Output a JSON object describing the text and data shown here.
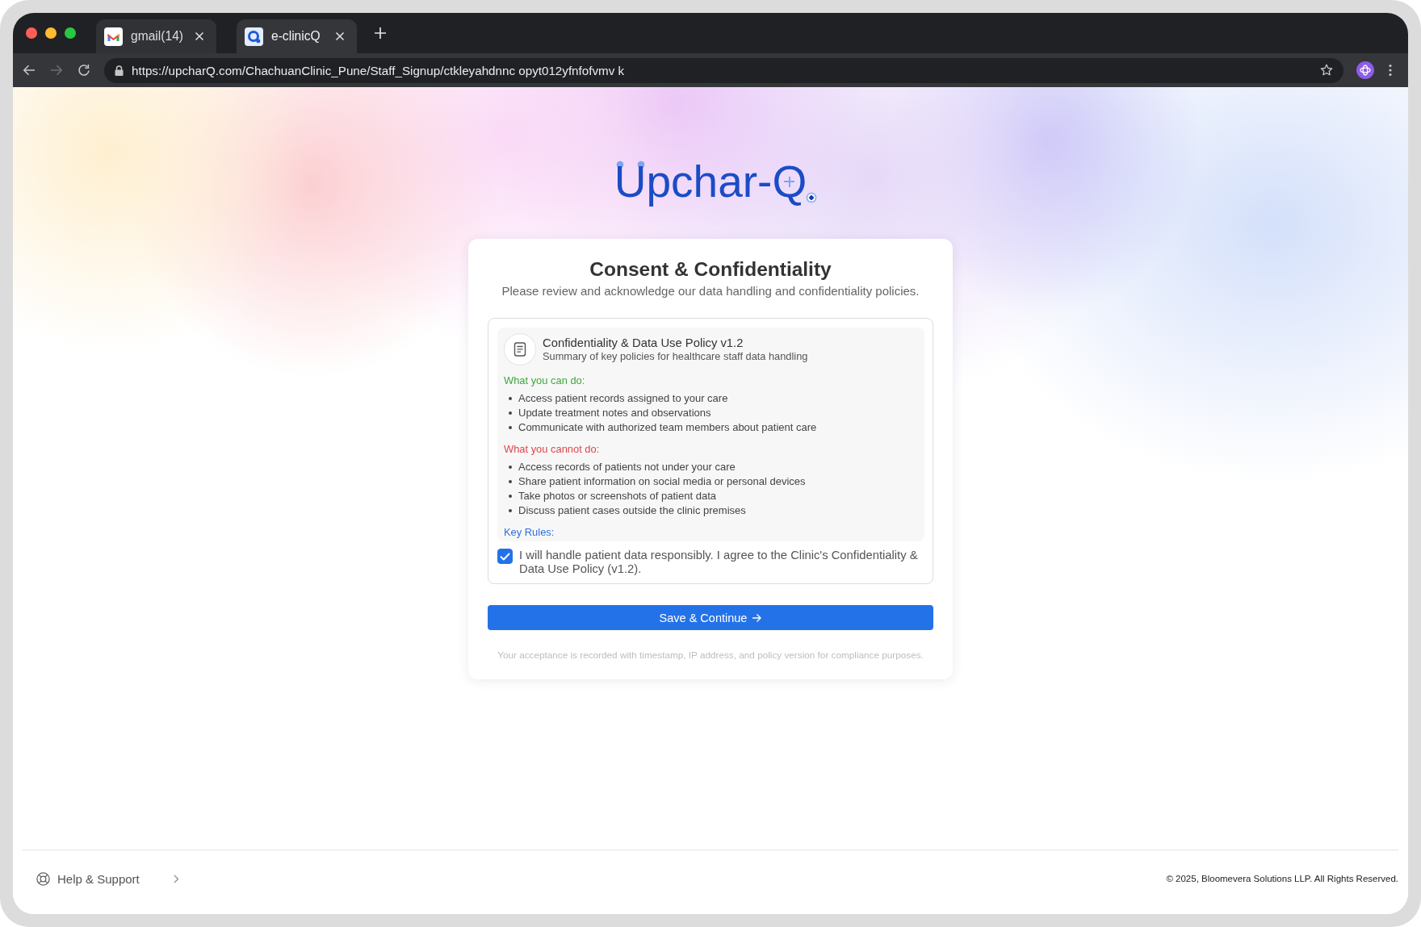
{
  "browser": {
    "tabs": [
      {
        "title": "gmail(14)",
        "kind": "mail",
        "selected": false
      },
      {
        "title": "e-clinicQ",
        "kind": "clinic",
        "selected": true
      }
    ],
    "forward_button": {
      "disabled": true
    },
    "address_bar": {
      "url": "https://upcharQ.com/ChachuanClinic_Pune/Staff_Signup/ctkleyahdnnc opyt012yfnfofvmv k"
    }
  },
  "logo": {
    "text": "Upchar-Q"
  },
  "card": {
    "title": "Consent & Confidentiality",
    "subtitle": "Please review and acknowledge our data handling and confidentiality policies.",
    "policy": {
      "title": "Confidentiality & Data Use Policy v1.2",
      "subtitle": "Summary of key policies for healthcare staff data handling",
      "sections": [
        {
          "kind": "allowed",
          "heading": "What you can do:",
          "items": [
            "Access patient records assigned to your care",
            "Update treatment notes and observations",
            "Communicate with authorized team members about patient care"
          ]
        },
        {
          "kind": "forbidden",
          "heading": "What you cannot do:",
          "items": [
            "Access records of patients not under your care",
            "Share patient information on social media or personal devices",
            "Take photos or screenshots of patient data",
            "Discuss patient cases outside the clinic premises"
          ]
        },
        {
          "kind": "rules",
          "heading": "Key Rules:"
        }
      ]
    },
    "consent": {
      "label": "I will handle patient data responsibly. I agree to the Clinic's Confidentiality & Data Use Policy (v1.2).",
      "checked": true
    },
    "primary_button": {
      "label": "Save & Continue"
    },
    "footnote": "Your acceptance is recorded with timestamp, IP address, and policy version for compliance purposes."
  },
  "footer": {
    "help_link": "Help & Support",
    "copyright": "© 2025, Bloomevera Solutions LLP. All Rights Reserved."
  }
}
